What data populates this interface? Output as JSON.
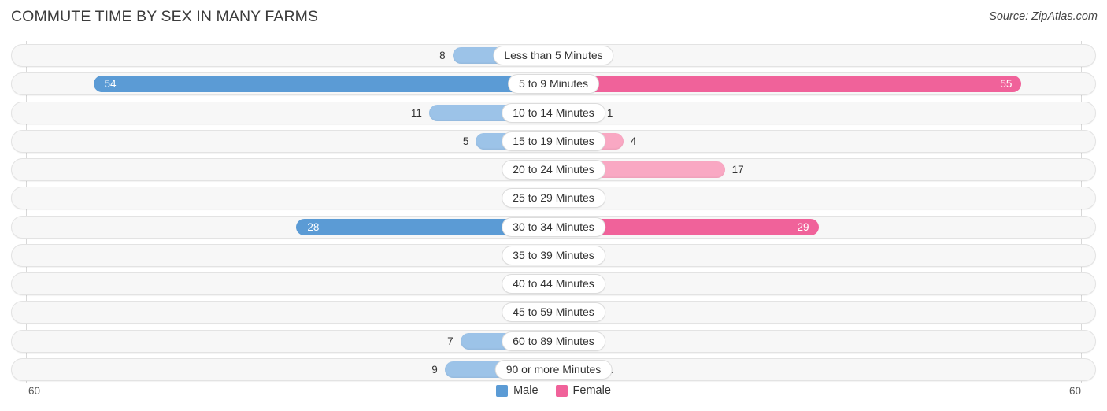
{
  "header": {
    "title": "COMMUTE TIME BY SEX IN MANY FARMS",
    "source": "Source: ZipAtlas.com"
  },
  "axis": {
    "left_tick": "60",
    "right_tick": "60"
  },
  "legend": {
    "items": [
      {
        "label": "Male",
        "color": "#5b9bd5"
      },
      {
        "label": "Female",
        "color": "#f0629a"
      }
    ]
  },
  "colors": {
    "male_strong": "#5b9bd5",
    "male_light": "#9cc3e8",
    "female_strong": "#f0629a",
    "female_light": "#f9a8c3",
    "track": "#f7f7f7",
    "track_border": "#e3e3e3"
  },
  "chart_data": {
    "type": "bar",
    "subtype": "diverging-bidirectional",
    "title": "COMMUTE TIME BY SEX IN MANY FARMS",
    "xlabel": "",
    "ylabel": "",
    "xlim": [
      60,
      60
    ],
    "axis_max": 60,
    "grid": false,
    "legend_position": "bottom-center",
    "categories": [
      "Less than 5 Minutes",
      "5 to 9 Minutes",
      "10 to 14 Minutes",
      "15 to 19 Minutes",
      "20 to 24 Minutes",
      "25 to 29 Minutes",
      "30 to 34 Minutes",
      "35 to 39 Minutes",
      "40 to 44 Minutes",
      "45 to 59 Minutes",
      "60 to 89 Minutes",
      "90 or more Minutes"
    ],
    "series": [
      {
        "name": "Male",
        "color": "#5b9bd5",
        "values": [
          8,
          54,
          11,
          5,
          0,
          0,
          28,
          0,
          0,
          0,
          7,
          9
        ]
      },
      {
        "name": "Female",
        "color": "#f0629a",
        "values": [
          1,
          55,
          1,
          4,
          17,
          0,
          29,
          0,
          0,
          0,
          0,
          1
        ]
      }
    ],
    "rows": [
      {
        "category": "Less than 5 Minutes",
        "male": 8,
        "female": 1
      },
      {
        "category": "5 to 9 Minutes",
        "male": 54,
        "female": 55
      },
      {
        "category": "10 to 14 Minutes",
        "male": 11,
        "female": 1
      },
      {
        "category": "15 to 19 Minutes",
        "male": 5,
        "female": 4
      },
      {
        "category": "20 to 24 Minutes",
        "male": 0,
        "female": 17
      },
      {
        "category": "25 to 29 Minutes",
        "male": 0,
        "female": 0
      },
      {
        "category": "30 to 34 Minutes",
        "male": 28,
        "female": 29
      },
      {
        "category": "35 to 39 Minutes",
        "male": 0,
        "female": 0
      },
      {
        "category": "40 to 44 Minutes",
        "male": 0,
        "female": 0
      },
      {
        "category": "45 to 59 Minutes",
        "male": 0,
        "female": 0
      },
      {
        "category": "60 to 89 Minutes",
        "male": 7,
        "female": 0
      },
      {
        "category": "90 or more Minutes",
        "male": 9,
        "female": 1
      }
    ]
  }
}
